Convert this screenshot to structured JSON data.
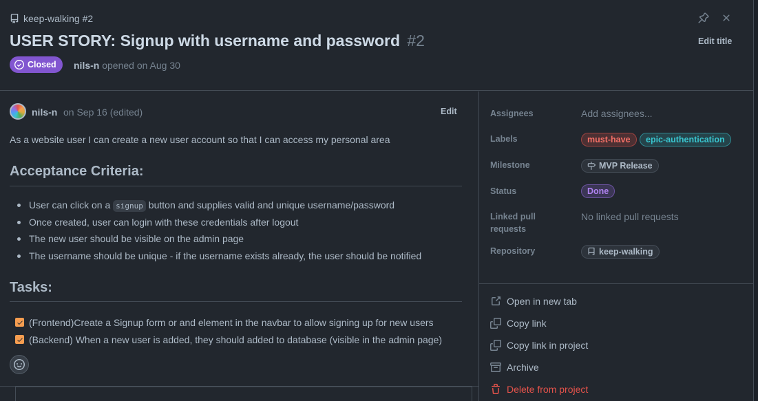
{
  "header": {
    "repo_ref": "keep-walking #2",
    "title": "USER STORY: Signup with username and password",
    "number": "#2",
    "edit_title": "Edit title",
    "status_badge": "Closed",
    "author": "nils-n",
    "opened_text": "opened on Aug 30"
  },
  "comment": {
    "author": "nils-n",
    "date": "on Sep 16 (edited)",
    "edit_label": "Edit",
    "description": "As a website user I can create a new user account so that I can access my personal area",
    "acceptance_heading": "Acceptance Criteria:",
    "criteria": {
      "c1_before": "User can click on a ",
      "c1_code": "signup",
      "c1_after": " button and supplies valid and unique username/password",
      "c2": "Once created, user can login with these credentials after logout",
      "c3": "The new user should be visible on the admin page",
      "c4": "The username should be unique - if the username exists already, the user should be notified"
    },
    "tasks_heading": "Tasks:",
    "tasks": [
      {
        "label": "(Frontend)Create a Signup form or and element in the navbar to allow signing up for new users",
        "checked": true
      },
      {
        "label": "(Backend) When a new user is added, they should added to database (visible in the admin page)",
        "checked": true
      }
    ]
  },
  "sidebar": {
    "assignees": {
      "label": "Assignees",
      "value": "Add assignees..."
    },
    "labels": {
      "label": "Labels",
      "items": [
        "must-have",
        "epic-authentication"
      ]
    },
    "milestone": {
      "label": "Milestone",
      "value": "MVP Release"
    },
    "status": {
      "label": "Status",
      "value": "Done"
    },
    "linked_prs": {
      "label_line1": "Linked pull",
      "label_line2": "requests",
      "value": "No linked pull requests"
    },
    "repository": {
      "label": "Repository",
      "value": "keep-walking"
    },
    "actions": {
      "open_new_tab": "Open in new tab",
      "copy_link": "Copy link",
      "copy_link_project": "Copy link in project",
      "archive": "Archive",
      "delete": "Delete from project"
    }
  },
  "colors": {
    "background": "#22272e",
    "closed_badge": "#8256d0",
    "must_have": "#e5534b",
    "epic_authentication": "#39c5cf",
    "done": "#986ee2",
    "danger": "#e5534b",
    "checkbox": "#f69d50"
  },
  "icons": [
    "repo-icon",
    "pin-icon",
    "close-icon",
    "closed-issue-icon",
    "smiley-icon",
    "milestone-icon",
    "link-external-icon",
    "copy-icon",
    "archive-icon",
    "trash-icon",
    "check-icon"
  ]
}
